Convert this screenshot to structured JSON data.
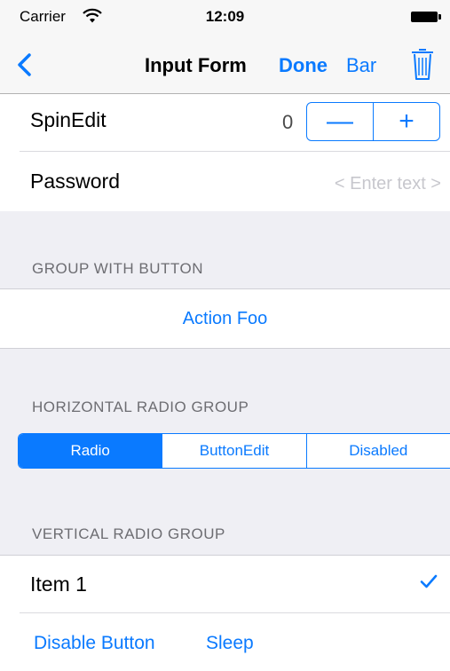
{
  "status_bar": {
    "carrier": "Carrier",
    "time": "12:09"
  },
  "nav": {
    "title": "Input Form",
    "done": "Done",
    "bar": "Bar"
  },
  "form": {
    "spinedit": {
      "label": "SpinEdit",
      "value": "0",
      "minus": "—",
      "plus": "+"
    },
    "password": {
      "label": "Password",
      "placeholder": "< Enter text >"
    }
  },
  "group_with_button": {
    "header": "GROUP WITH BUTTON",
    "action": "Action Foo"
  },
  "horizontal_radio": {
    "header": "HORIZONTAL RADIO GROUP",
    "options": [
      "Radio",
      "ButtonEdit",
      "Disabled"
    ],
    "selected": "Radio"
  },
  "vertical_radio": {
    "header": "VERTICAL RADIO GROUP",
    "items": [
      {
        "label": "Item 1",
        "checked": true
      }
    ]
  },
  "bottom": {
    "disable_button": "Disable Button",
    "sleep": "Sleep"
  },
  "colors": {
    "accent": "#0a7aff",
    "background": "#efeff4"
  }
}
